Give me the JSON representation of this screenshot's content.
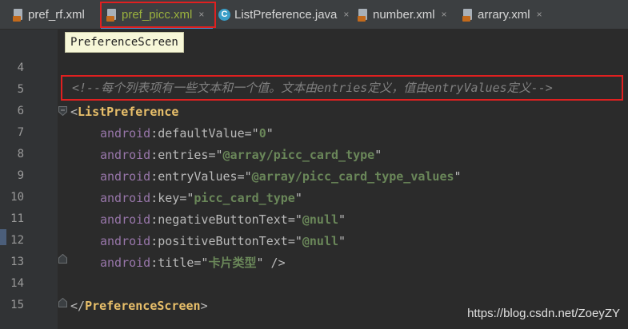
{
  "tabs": [
    {
      "label": "pref_rf.xml",
      "icon": "xml-file-icon",
      "active": false
    },
    {
      "label": "pref_picc.xml",
      "icon": "xml-file-icon",
      "active": true
    },
    {
      "label": "ListPreference.java",
      "icon": "java-class-icon",
      "active": false
    },
    {
      "label": "number.xml",
      "icon": "xml-file-icon",
      "active": false
    },
    {
      "label": "arrary.xml",
      "icon": "xml-file-icon",
      "active": false
    }
  ],
  "close_glyph": "×",
  "tooltip": "PreferenceScreen",
  "line_numbers": [
    "4",
    "5",
    "6",
    "7",
    "8",
    "9",
    "10",
    "11",
    "12",
    "13",
    "14",
    "15"
  ],
  "code": {
    "comment": "<!--每个列表项有一些文本和一个值。文本由entries定义，值由entryValues定义-->",
    "open_tag": "ListPreference",
    "ns": "android",
    "attributes": [
      {
        "name": "defaultValue",
        "value": "0"
      },
      {
        "name": "entries",
        "value": "@array/picc_card_type"
      },
      {
        "name": "entryValues",
        "value": "@array/picc_card_type_values"
      },
      {
        "name": "key",
        "value": "picc_card_type"
      },
      {
        "name": "negativeButtonText",
        "value": "@null"
      },
      {
        "name": "positiveButtonText",
        "value": "@null"
      },
      {
        "name": "title",
        "value": "卡片类型"
      }
    ],
    "self_close": "/>",
    "close_tag": "PreferenceScreen"
  },
  "watermark": "https://blog.csdn.net/ZoeyZY",
  "colors": {
    "highlight_box": "#e02020",
    "tag": "#e8bf6a",
    "string": "#6a8759",
    "namespace": "#9876aa",
    "comment": "#808080"
  }
}
